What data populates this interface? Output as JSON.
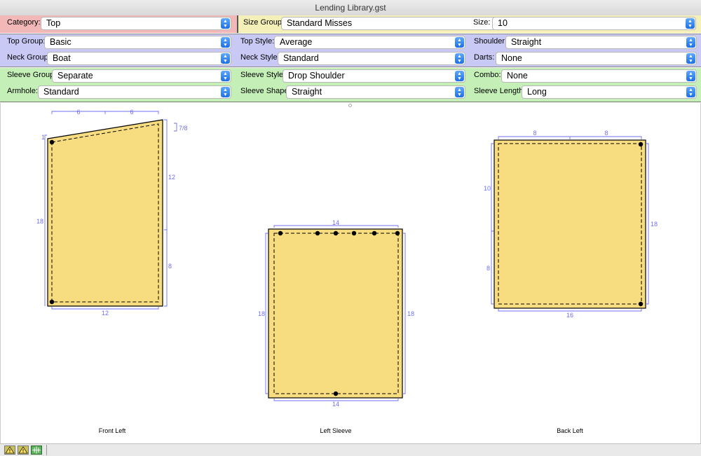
{
  "window": {
    "title": "Lending Library.gst"
  },
  "colors": {
    "category_band": "#f2b8b8",
    "size_band": "#f5f0b8",
    "top_band": "#c9c9f6",
    "sleeve_band": "#c4f0b8",
    "piece_fill": "#f8dc80",
    "dimension": "#6e6ef2"
  },
  "category": {
    "label": "Category:",
    "value": "Top"
  },
  "size_group": {
    "label": "Size Group:",
    "value": "Standard Misses"
  },
  "size": {
    "label": "Size:",
    "value": "10"
  },
  "top_group": {
    "label": "Top Group:",
    "value": "Basic"
  },
  "top_style": {
    "label": "Top Style:",
    "value": "Average"
  },
  "shoulder": {
    "label": "Shoulder:",
    "value": "Straight"
  },
  "neck_group": {
    "label": "Neck Group:",
    "value": "Boat"
  },
  "neck_style": {
    "label": "Neck Style:",
    "value": "Standard"
  },
  "darts": {
    "label": "Darts:",
    "value": "None"
  },
  "sleeve_group": {
    "label": "Sleeve Group:",
    "value": "Separate"
  },
  "sleeve_style": {
    "label": "Sleeve Style:",
    "value": "Drop Shoulder"
  },
  "combo": {
    "label": "Combo:",
    "value": "None"
  },
  "armhole": {
    "label": "Armhole:",
    "value": "Standard"
  },
  "sleeve_shape": {
    "label": "Sleeve Shape:",
    "value": "Straight"
  },
  "sleeve_length": {
    "label": "Sleeve Length:",
    "value": "Long"
  },
  "pieces": {
    "front_left": {
      "name": "Front Left",
      "dims": {
        "top_a": "6",
        "top_b": "6",
        "slope": "7/8",
        "left_top": "1",
        "left": "18",
        "right_upper": "12",
        "right_lower": "8",
        "bottom": "12"
      }
    },
    "left_sleeve": {
      "name": "Left Sleeve",
      "dims": {
        "top": "14",
        "left": "18",
        "right": "18",
        "bottom": "14"
      }
    },
    "back_left": {
      "name": "Back Left",
      "dims": {
        "top_a": "8",
        "top_b": "8",
        "left_upper": "10",
        "left_lower": "8",
        "right": "18",
        "bottom": "16"
      }
    }
  },
  "statusbar": {
    "icons": [
      "warning-icon",
      "warning-number-icon",
      "grid-icon"
    ]
  }
}
